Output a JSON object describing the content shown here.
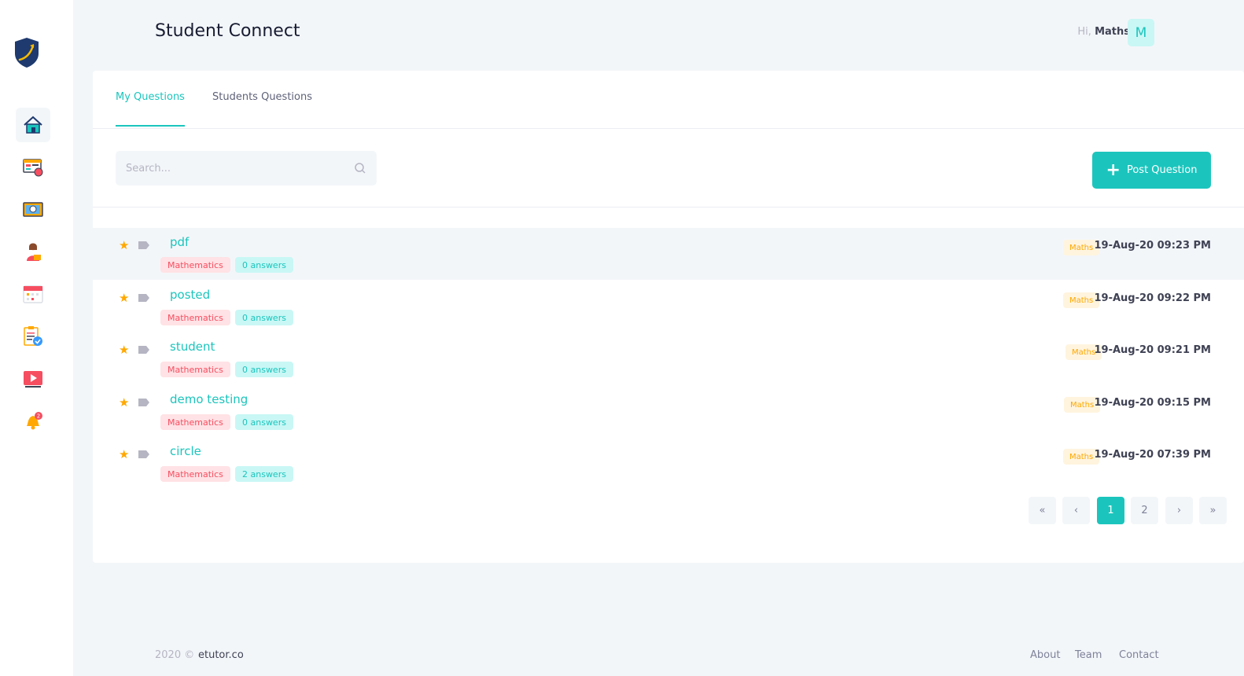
{
  "header": {
    "title": "Student Connect",
    "greeting_prefix": "Hi,",
    "user_name": "Maths",
    "avatar_letter": "M"
  },
  "sidebar": {
    "items": [
      {
        "icon": "home-icon",
        "active": true
      },
      {
        "icon": "dashboard-icon"
      },
      {
        "icon": "video-class-icon"
      },
      {
        "icon": "tutor-icon"
      },
      {
        "icon": "calendar-icon"
      },
      {
        "icon": "assignment-icon"
      },
      {
        "icon": "youtube-icon"
      },
      {
        "icon": "bell-icon",
        "badge": "2"
      }
    ]
  },
  "tabs": [
    {
      "label": "My Questions",
      "active": true
    },
    {
      "label": "Students Questions",
      "active": false
    }
  ],
  "search": {
    "placeholder": "Search..."
  },
  "post_button": {
    "label": "Post Question"
  },
  "questions": [
    {
      "title": "pdf",
      "subject": "Mathematics",
      "answers": "0 answers",
      "category": "Maths",
      "date": "19-Aug-20 09:23 PM"
    },
    {
      "title": "posted",
      "subject": "Mathematics",
      "answers": "0 answers",
      "category": "Maths",
      "date": "19-Aug-20 09:22 PM"
    },
    {
      "title": "student",
      "subject": "Mathematics",
      "answers": "0 answers",
      "category": "Maths",
      "date": "19-Aug-20 09:21 PM"
    },
    {
      "title": "demo testing",
      "subject": "Mathematics",
      "answers": "0 answers",
      "category": "Maths",
      "date": "19-Aug-20 09:15 PM"
    },
    {
      "title": "circle",
      "subject": "Mathematics",
      "answers": "2 answers",
      "category": "Maths",
      "date": "19-Aug-20 07:39 PM"
    }
  ],
  "pagination": {
    "first": "«",
    "prev": "‹",
    "pages": [
      "1",
      "2"
    ],
    "current": "1",
    "next": "›",
    "last": "»"
  },
  "footer": {
    "year": "2020 ©",
    "brand": "etutor.co",
    "links": [
      "About",
      "Team",
      "Contact"
    ]
  },
  "colors": {
    "accent": "#1bc5bd",
    "danger": "#f64e60",
    "warning": "#ffa800"
  }
}
